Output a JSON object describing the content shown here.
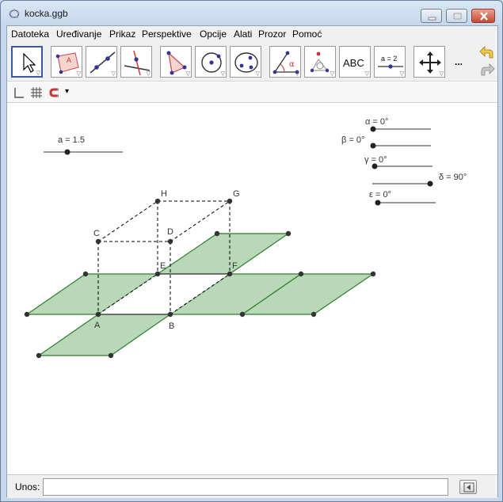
{
  "window": {
    "title": "kocka.ggb",
    "buttons": [
      "minimize",
      "maximize",
      "close"
    ]
  },
  "menu": {
    "items": [
      "Datoteka",
      "Uređivanje",
      "Prikaz",
      "Perspektive",
      "Opcije",
      "Alati",
      "Prozor",
      "Pomoć"
    ]
  },
  "toolbar": {
    "tools": [
      {
        "name": "move-tool",
        "icon": "cursor-arrow-icon",
        "active": true
      },
      {
        "name": "polygon-label-tool",
        "icon": "polygon-point-icon",
        "text": "A"
      },
      {
        "name": "line-tool",
        "icon": "line-through-points-icon"
      },
      {
        "name": "perpendicular-tool",
        "icon": "perpendicular-line-icon"
      },
      {
        "name": "polygon-tool",
        "icon": "triangle-icon"
      },
      {
        "name": "circle-tool",
        "icon": "circle-center-point-icon"
      },
      {
        "name": "conic-tool",
        "icon": "ellipse-icon"
      },
      {
        "name": "angle-tool",
        "icon": "angle-icon",
        "text": "α"
      },
      {
        "name": "reflect-tool",
        "icon": "reflect-point-icon"
      },
      {
        "name": "text-tool",
        "icon": "text-icon",
        "text": "ABC"
      },
      {
        "name": "slider-tool",
        "icon": "slider-icon",
        "text": "a = 2"
      },
      {
        "name": "move-graphics-tool",
        "icon": "move-cross-icon"
      }
    ],
    "more_label": "...",
    "undo_icon": "undo-arrow-icon",
    "redo_icon": "redo-arrow-icon"
  },
  "stylebar": {
    "icons": [
      "axes-icon",
      "grid-icon",
      "magnet-icon"
    ],
    "dropdown": "▾"
  },
  "graphics": {
    "sliders": [
      {
        "label": "a = 1.5"
      },
      {
        "label": "α = 0°"
      },
      {
        "label": "β = 0°"
      },
      {
        "label": "γ = 0°"
      },
      {
        "label": "δ = 90°"
      },
      {
        "label": "ε = 0°"
      }
    ],
    "points": {
      "A": "A",
      "B": "B",
      "C": "C",
      "D": "D",
      "E": "E",
      "F": "F",
      "G": "G",
      "H": "H"
    },
    "colors": {
      "face_fill": "#9fc89f",
      "face_stroke": "#2e7d2e",
      "point": "#333333"
    }
  },
  "input": {
    "label": "Unos:",
    "value": "",
    "placeholder": ""
  }
}
